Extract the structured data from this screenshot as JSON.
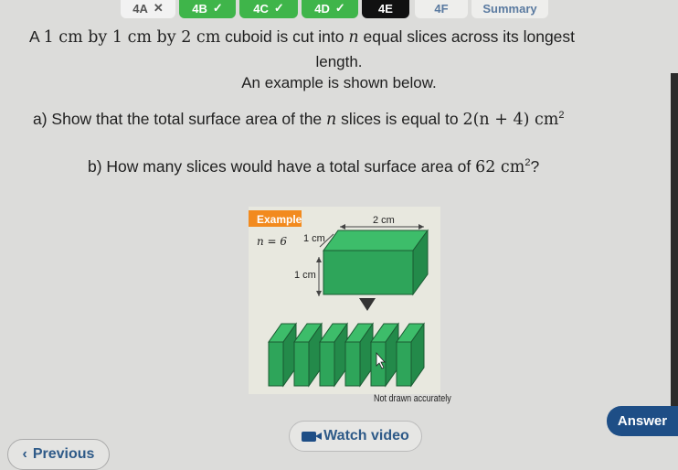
{
  "tabs": [
    {
      "label": "4A",
      "mark": "✕",
      "state": "incorrect"
    },
    {
      "label": "4B",
      "mark": "✓",
      "state": "correct"
    },
    {
      "label": "4C",
      "mark": "✓",
      "state": "correct"
    },
    {
      "label": "4D",
      "mark": "✓",
      "state": "correct"
    },
    {
      "label": "4E",
      "mark": "",
      "state": "active"
    },
    {
      "label": "4F",
      "mark": "",
      "state": "pending"
    },
    {
      "label": "Summary",
      "mark": "",
      "state": "pending"
    }
  ],
  "question": {
    "intro_a": "A ",
    "intro_dims": "1 cm by 1 cm by 2 cm",
    "intro_b": " cuboid is cut into ",
    "intro_n": "n",
    "intro_c": " equal slices across its longest",
    "intro_line2": "length.",
    "intro_line3": "An example is shown below.",
    "part_a_text": "a) Show that the total surface area of the ",
    "part_a_n": "n",
    "part_a_text2": " slices is equal to ",
    "part_a_expr": "2(n + 4) cm",
    "part_a_exp": "2",
    "part_b_text": "b) How many slices would have a total surface area of ",
    "part_b_value": "62 cm",
    "part_b_exp": "2",
    "part_b_end": "?"
  },
  "figure": {
    "example_label": "Example",
    "n_label": "n = 6",
    "len_label": "2 cm",
    "depth_label": "1 cm",
    "height_label": "1 cm",
    "caption": "Not drawn accurately",
    "slice_count": 6
  },
  "buttons": {
    "previous": "Previous",
    "watch_video": "Watch video",
    "answer": "Answer"
  },
  "colors": {
    "correct": "#3fb54a",
    "active": "#111111",
    "button_blue": "#1e4e86",
    "cuboid_green": "#2ea55a"
  }
}
